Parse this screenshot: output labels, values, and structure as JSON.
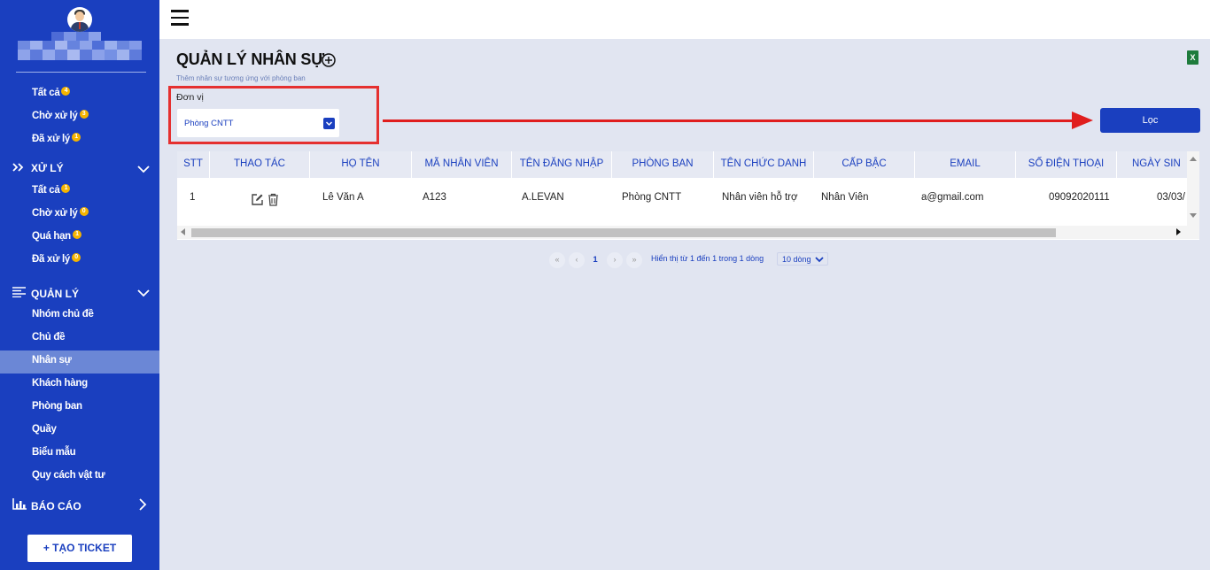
{
  "sidebar": {
    "top_items": [
      {
        "label": "Tất cả",
        "badge": "4"
      },
      {
        "label": "Chờ xử lý",
        "badge": "3"
      },
      {
        "label": "Đã xử lý",
        "badge": "1"
      }
    ],
    "xu_ly": {
      "title": "XỬ LÝ",
      "items": [
        {
          "label": "Tất cả",
          "badge": "1"
        },
        {
          "label": "Chờ xử lý",
          "badge": "0"
        },
        {
          "label": "Quá hạn",
          "badge": "1"
        },
        {
          "label": "Đã xử lý",
          "badge": "0"
        }
      ]
    },
    "quan_ly": {
      "title": "QUẢN LÝ",
      "items": [
        {
          "label": "Nhóm chủ đề"
        },
        {
          "label": "Chủ đề"
        },
        {
          "label": "Nhân sự",
          "active": true
        },
        {
          "label": "Khách hàng"
        },
        {
          "label": "Phòng ban"
        },
        {
          "label": "Quầy"
        },
        {
          "label": "Biểu mẫu"
        },
        {
          "label": "Quy cách vật tư"
        }
      ]
    },
    "bao_cao": {
      "title": "BÁO CÁO"
    },
    "ticket_button": "+ TẠO TICKET"
  },
  "main": {
    "title": "QUẢN LÝ NHÂN SỰ",
    "subtitle": "Thêm nhân sự tương ứng với phòng ban",
    "filter": {
      "label": "Đơn vị",
      "value": "Phòng CNTT"
    },
    "filter_button": "Lọc",
    "excel_icon_text": "X"
  },
  "table": {
    "columns": [
      "STT",
      "THAO TÁC",
      "HỌ TÊN",
      "MÃ NHÂN VIÊN",
      "TÊN ĐĂNG NHẬP",
      "PHÒNG BAN",
      "TÊN CHỨC DANH",
      "CẤP BẬC",
      "EMAIL",
      "SỐ ĐIỆN THOẠI",
      "NGÀY SIN"
    ],
    "rows": [
      {
        "stt": "1",
        "ho_ten": "Lê Văn A",
        "ma_nv": "A123",
        "ten_dang_nhap": "A.LEVAN",
        "phong_ban": "Phòng CNTT",
        "chuc_danh": "Nhân viên hỗ trợ",
        "cap_bac": "Nhân Viên",
        "email": "a@gmail.com",
        "sdt": "09092020111",
        "ngay_sinh": "03/03/"
      }
    ]
  },
  "pagination": {
    "first": "«",
    "prev": "‹",
    "current": "1",
    "next": "›",
    "last": "»",
    "info": "Hiển thị từ 1 đến 1 trong 1 dòng",
    "page_size": "10 dòng"
  },
  "colors": {
    "primary": "#1a3fbf",
    "badge": "#f5b400",
    "highlight": "#e53030",
    "background": "#e1e5f1"
  }
}
